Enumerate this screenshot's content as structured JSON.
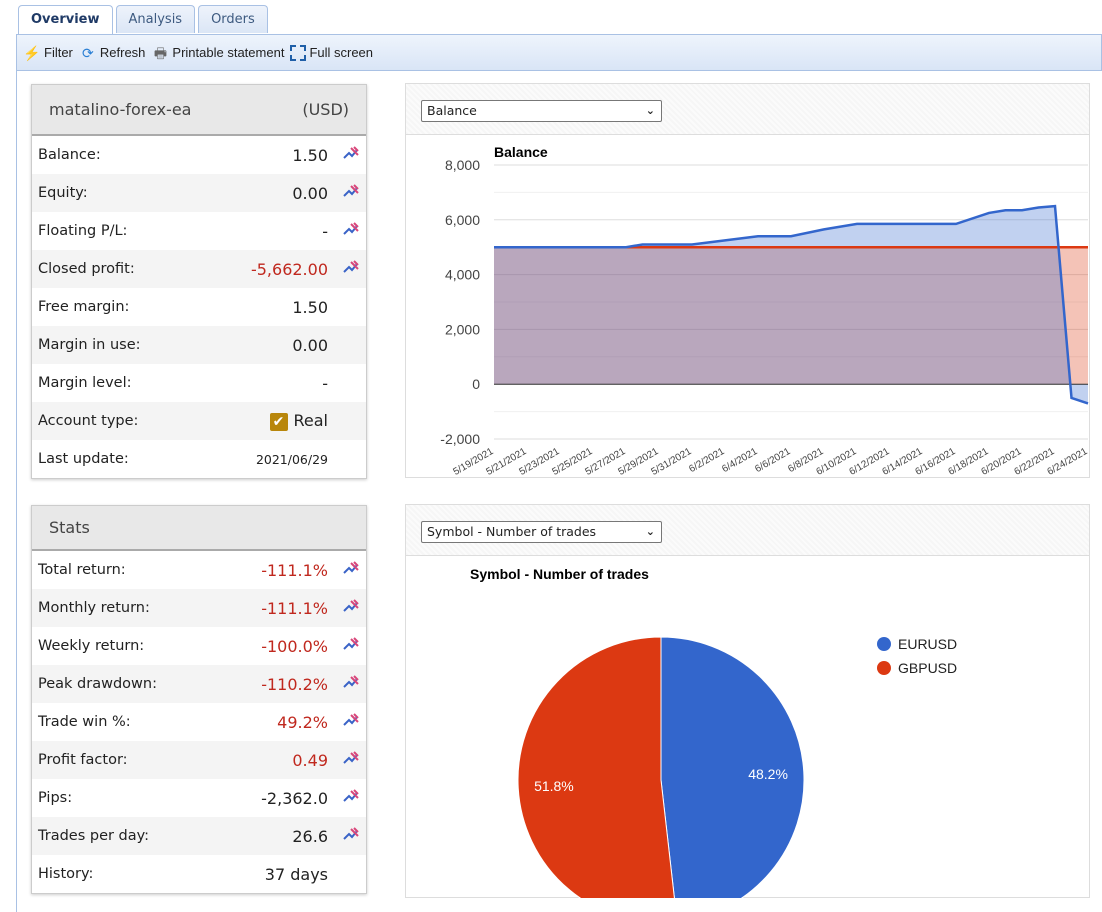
{
  "tabs": [
    {
      "label": "Overview",
      "active": true
    },
    {
      "label": "Analysis"
    },
    {
      "label": "Orders"
    }
  ],
  "toolbar": {
    "filter": "Filter",
    "refresh": "Refresh",
    "print": "Printable statement",
    "fullscreen": "Full screen"
  },
  "account": {
    "name": "matalino-forex-ea",
    "currency": "(USD)",
    "rows": [
      {
        "label": "Balance:",
        "value": "1.50",
        "edit": true
      },
      {
        "label": "Equity:",
        "value": "0.00",
        "edit": true
      },
      {
        "label": "Floating P/L:",
        "value": "-",
        "edit": true
      },
      {
        "label": "Closed profit:",
        "value": "-5,662.00",
        "edit": true,
        "negative": true
      },
      {
        "label": "Free margin:",
        "value": "1.50"
      },
      {
        "label": "Margin in use:",
        "value": "0.00"
      },
      {
        "label": "Margin level:",
        "value": "-"
      },
      {
        "label": "Account type:",
        "value": "Real",
        "checkbox": true
      },
      {
        "label": "Last update:",
        "value": "2021/06/29",
        "small": true
      }
    ]
  },
  "stats": {
    "title": "Stats",
    "rows": [
      {
        "label": "Total return:",
        "value": "-111.1%",
        "edit": true,
        "negative": true
      },
      {
        "label": "Monthly return:",
        "value": "-111.1%",
        "edit": true,
        "negative": true
      },
      {
        "label": "Weekly return:",
        "value": "-100.0%",
        "edit": true,
        "negative": true
      },
      {
        "label": "Peak drawdown:",
        "value": "-110.2%",
        "edit": true,
        "negative": true
      },
      {
        "label": "Trade win %:",
        "value": "49.2%",
        "edit": true,
        "negative": true
      },
      {
        "label": "Profit factor:",
        "value": "0.49",
        "edit": true,
        "negative": true
      },
      {
        "label": "Pips:",
        "value": "-2,362.0",
        "edit": true
      },
      {
        "label": "Trades per day:",
        "value": "26.6",
        "edit": true
      },
      {
        "label": "History:",
        "value": "37 days"
      }
    ]
  },
  "balance_select": "Balance",
  "pie_select": "Symbol - Number of trades",
  "chart_data": [
    {
      "type": "area",
      "title": "Balance",
      "ylim": [
        -2000,
        8000
      ],
      "yticks": [
        -2000,
        0,
        2000,
        4000,
        6000,
        8000
      ],
      "ytick_labels": [
        "-2,000",
        "0",
        "2,000",
        "4,000",
        "6,000",
        "8,000"
      ],
      "xtick_labels": [
        "5/19/2021",
        "5/21/2021",
        "5/23/2021",
        "5/25/2021",
        "5/27/2021",
        "5/29/2021",
        "5/31/2021",
        "6/2/2021",
        "6/4/2021",
        "6/6/2021",
        "6/8/2021",
        "6/10/2021",
        "6/12/2021",
        "6/14/2021",
        "6/16/2021",
        "6/18/2021",
        "6/20/2021",
        "6/22/2021",
        "6/24/2021"
      ],
      "grid": true,
      "series": [
        {
          "color": "#3366cc",
          "x": [
            "5/19/2021",
            "5/27/2021",
            "5/28/2021",
            "5/31/2021",
            "6/2/2021",
            "6/4/2021",
            "6/6/2021",
            "6/8/2021",
            "6/10/2021",
            "6/16/2021",
            "6/18/2021",
            "6/19/2021",
            "6/20/2021",
            "6/21/2021",
            "6/22/2021",
            "6/23/2021",
            "6/24/2021"
          ],
          "y": [
            5000,
            5000,
            5100,
            5100,
            5250,
            5400,
            5400,
            5650,
            5850,
            5850,
            6250,
            6350,
            6350,
            6450,
            6500,
            -500,
            -700
          ]
        },
        {
          "color": "#dc3912",
          "x": [
            "5/19/2021",
            "6/24/2021"
          ],
          "y": [
            5000,
            5000
          ]
        }
      ]
    },
    {
      "type": "pie",
      "title": "Symbol - Number of trades",
      "legend": "right",
      "slices": [
        {
          "label": "EURUSD",
          "value": 48.2,
          "display": "48.2%",
          "color": "#3366cc"
        },
        {
          "label": "GBPUSD",
          "value": 51.8,
          "display": "51.8%",
          "color": "#dc3912"
        }
      ]
    }
  ]
}
